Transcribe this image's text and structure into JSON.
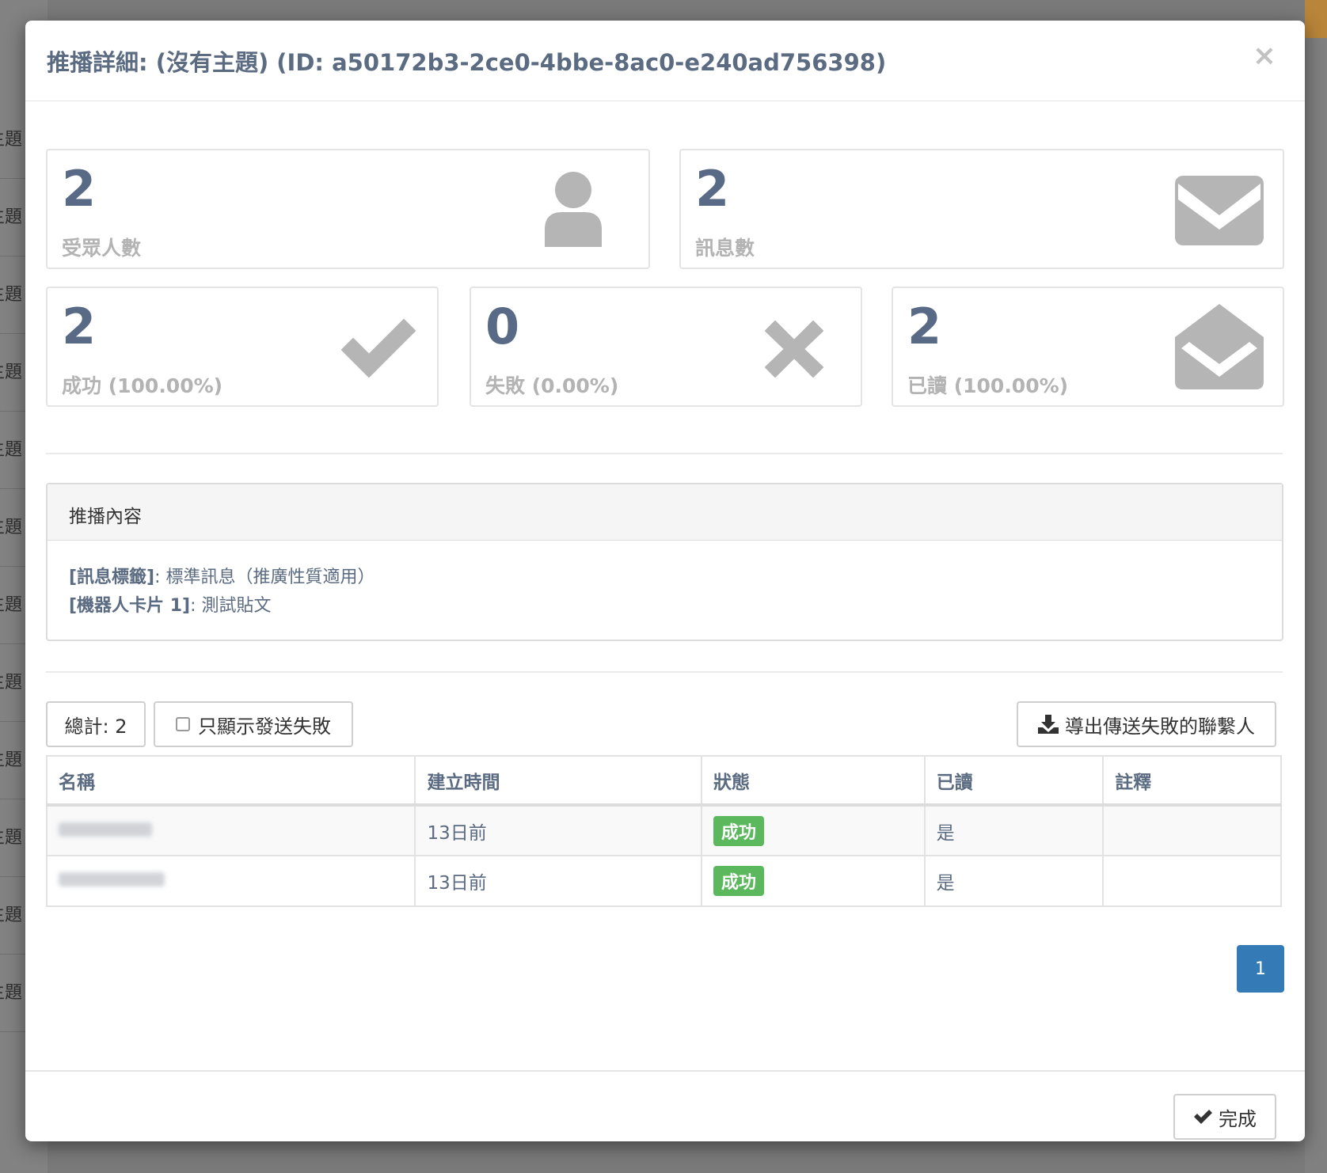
{
  "backdrop": {
    "row_label": "主題"
  },
  "modal": {
    "title": "推播詳細: (沒有主題) (ID: a50172b3-2ce0-4bbe-8ac0-e240ad756398)",
    "close_label": "×"
  },
  "stats": {
    "audience": {
      "value": "2",
      "label": "受眾人數",
      "icon": "user-icon"
    },
    "messages": {
      "value": "2",
      "label": "訊息數",
      "icon": "envelope-icon"
    },
    "success": {
      "value": "2",
      "label": "成功 (100.00%)",
      "icon": "check-icon"
    },
    "failed": {
      "value": "0",
      "label": "失敗 (0.00%)",
      "icon": "times-icon"
    },
    "read": {
      "value": "2",
      "label": "已讀 (100.00%)",
      "icon": "envelope-open-icon"
    }
  },
  "content_panel": {
    "heading": "推播內容",
    "lines": [
      {
        "key": "[訊息標籤]",
        "sep": ": ",
        "value": "標準訊息（推廣性質適用）"
      },
      {
        "key": "[機器人卡片 1]",
        "sep": ": ",
        "value": "測試貼文"
      }
    ]
  },
  "toolbar": {
    "total_label": "總計: 2",
    "failed_only_label": "只顯示發送失敗",
    "export_label": "導出傳送失敗的聯繫人"
  },
  "table": {
    "headers": [
      "名稱",
      "建立時間",
      "狀態",
      "已讀",
      "註釋"
    ],
    "rows": [
      {
        "created": "13日前",
        "status": "成功",
        "read": "是",
        "note": ""
      },
      {
        "created": "13日前",
        "status": "成功",
        "read": "是",
        "note": ""
      }
    ]
  },
  "pagination": {
    "current": "1"
  },
  "footer": {
    "done_label": "完成"
  },
  "colors": {
    "title": "#5b6b82",
    "icon_gray": "#b3b3b3",
    "success": "#5cb85c",
    "primary": "#337ab7"
  }
}
